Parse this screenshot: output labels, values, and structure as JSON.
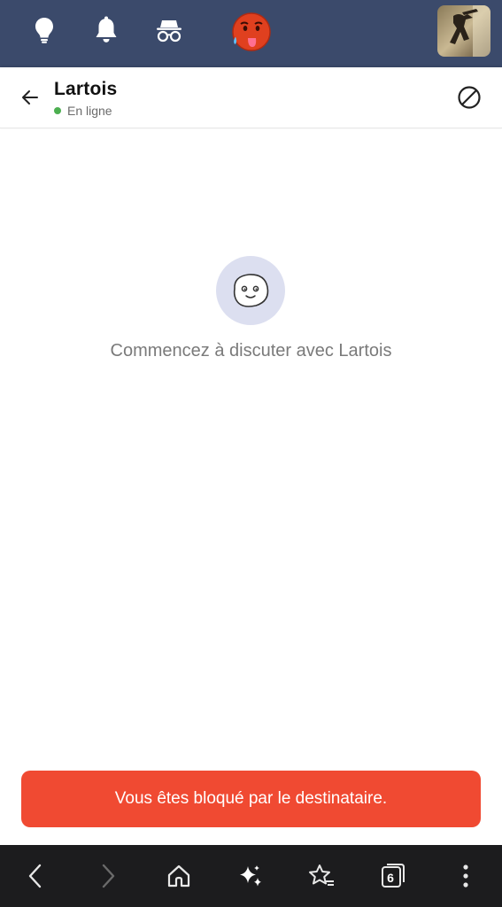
{
  "topbar": {
    "icons": [
      "lightbulb-icon",
      "bell-icon",
      "incognito-icon",
      "hot-face-emoji",
      "profile-avatar"
    ],
    "background": "#3b4a6b"
  },
  "chat": {
    "contact_name": "Lartois",
    "status": "En ligne",
    "status_color": "#4caf50",
    "empty_message": "Commencez à discuter avec Lartois"
  },
  "banner": {
    "text": "Vous êtes bloqué par le destinataire.",
    "color": "#f04a32"
  },
  "browser_bar": {
    "tab_count": "6",
    "icons": [
      "back-icon",
      "forward-icon",
      "home-icon",
      "sparkle-icon",
      "bookmark-star-icon",
      "tabs-icon",
      "more-icon"
    ]
  }
}
